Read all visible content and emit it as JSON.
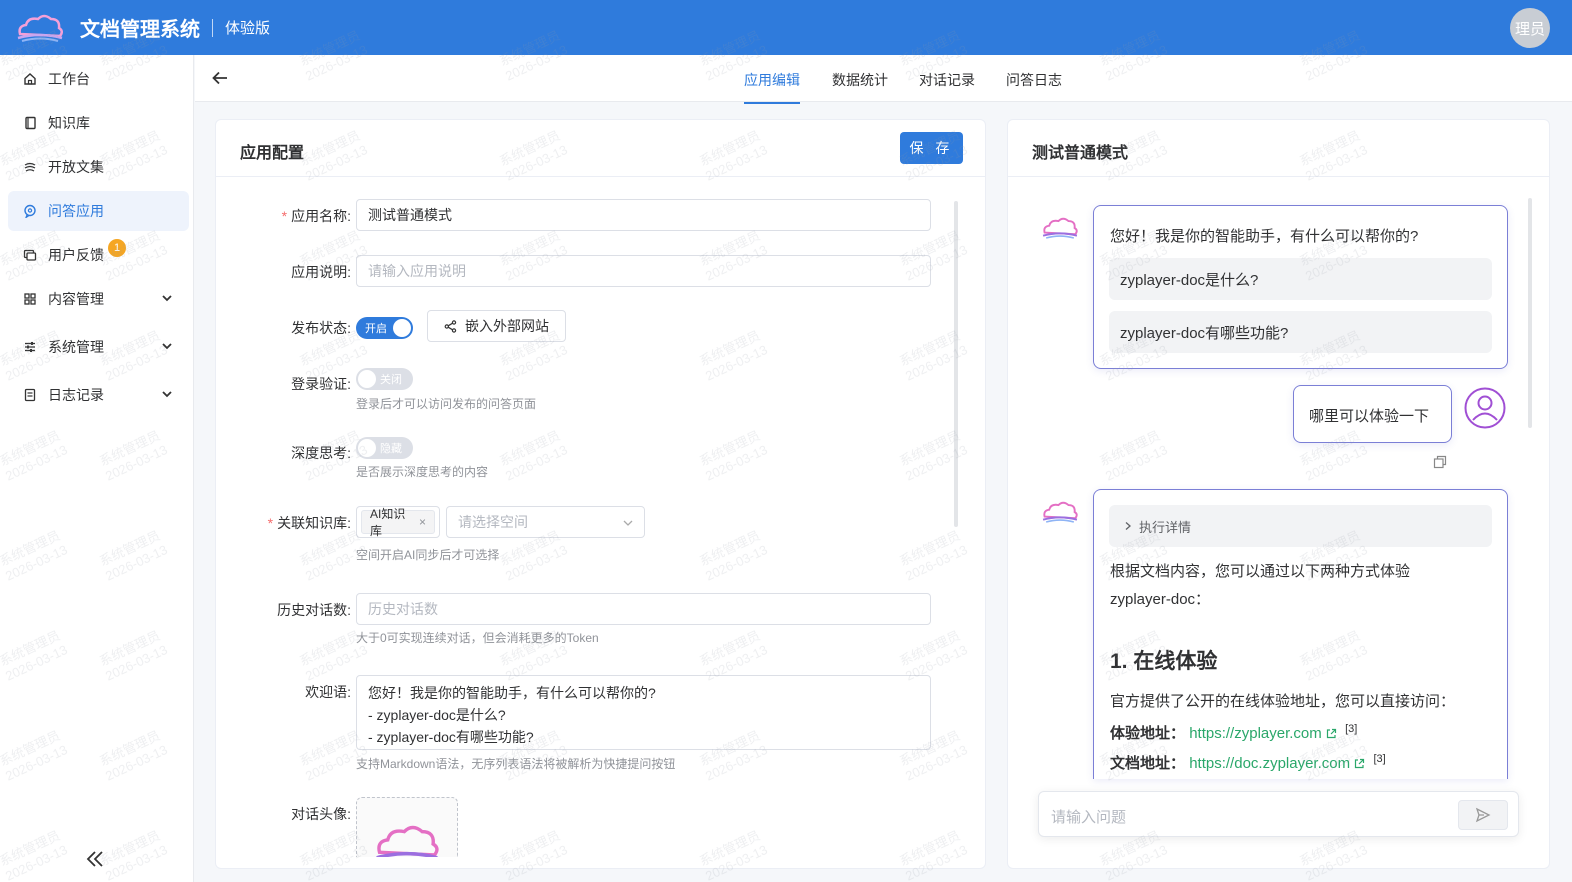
{
  "header": {
    "title": "文档管理系统",
    "edition": "体验版",
    "user_avatar_text": "理员"
  },
  "sidebar": {
    "items": [
      {
        "label": "工作台",
        "icon": "home-icon"
      },
      {
        "label": "知识库",
        "icon": "book-icon"
      },
      {
        "label": "开放文集",
        "icon": "open-collection-icon"
      },
      {
        "label": "问答应用",
        "icon": "qa-app-icon",
        "active": true
      },
      {
        "label": "用户反馈",
        "icon": "feedback-icon",
        "badge": "1"
      },
      {
        "label": "内容管理",
        "icon": "grid-icon",
        "expandable": true
      },
      {
        "label": "系统管理",
        "icon": "sliders-icon",
        "expandable": true
      },
      {
        "label": "日志记录",
        "icon": "log-icon",
        "expandable": true
      }
    ]
  },
  "tabs": {
    "items": [
      "应用编辑",
      "数据统计",
      "对话记录",
      "问答日志"
    ],
    "active": "应用编辑"
  },
  "config": {
    "title": "应用配置",
    "save_label": "保 存",
    "app_name_label": "应用名称:",
    "app_name_value": "测试普通模式",
    "app_desc_label": "应用说明:",
    "app_desc_placeholder": "请输入应用说明",
    "publish_label": "发布状态:",
    "publish_toggle": "开启",
    "publish_on": true,
    "embed_label": "嵌入外部网站",
    "login_label": "登录验证:",
    "login_toggle": "关闭",
    "login_on": false,
    "login_hint": "登录后才可以访问发布的问答页面",
    "think_label": "深度思考:",
    "think_toggle": "隐藏",
    "think_on": false,
    "think_hint": "是否展示深度思考的内容",
    "kb_label": "关联知识库:",
    "kb_tag": "AI知识库",
    "kb_space_placeholder": "请选择空间",
    "kb_hint": "空间开启AI同步后才可选择",
    "history_label": "历史对话数:",
    "history_placeholder": "历史对话数",
    "history_hint": "大于0可实现连续对话，但会消耗更多的Token",
    "welcome_label": "欢迎语:",
    "welcome_value": "您好！我是你的智能助手，有什么可以帮你的?\n- zyplayer-doc是什么?\n- zyplayer-doc有哪些功能?",
    "welcome_hint": "支持Markdown语法，无序列表语法将被解析为快捷提问按钮",
    "avatar_label": "对话头像:"
  },
  "chat": {
    "title": "测试普通模式",
    "greeting": "您好！我是你的智能助手，有什么可以帮你的?",
    "suggestions": [
      "zyplayer-doc是什么?",
      "zyplayer-doc有哪些功能?"
    ],
    "user_message": "哪里可以体验一下",
    "exec_details": "执行详情",
    "answer_intro_1": "根据文档内容，您可以通过以下两种方式体验",
    "answer_intro_2": "zyplayer-doc：",
    "answer_heading": "1. 在线体验",
    "answer_line": "官方提供了公开的在线体验地址，您可以直接访问：",
    "link1_label": "体验地址",
    "link1_url": "https://zyplayer.com",
    "link1_ref": "[3]",
    "link2_label": "文档地址",
    "link2_url": "https://doc.zyplayer.com",
    "link2_ref": "[3]",
    "input_placeholder": "请输入问题"
  },
  "watermark": {
    "line1": "系统管理员",
    "line2": "2026-03-13"
  },
  "colors": {
    "primary": "#2f7bdc",
    "link": "#2aa76a",
    "bubble_border": "#7b7fd6",
    "badge": "#f5a623"
  }
}
